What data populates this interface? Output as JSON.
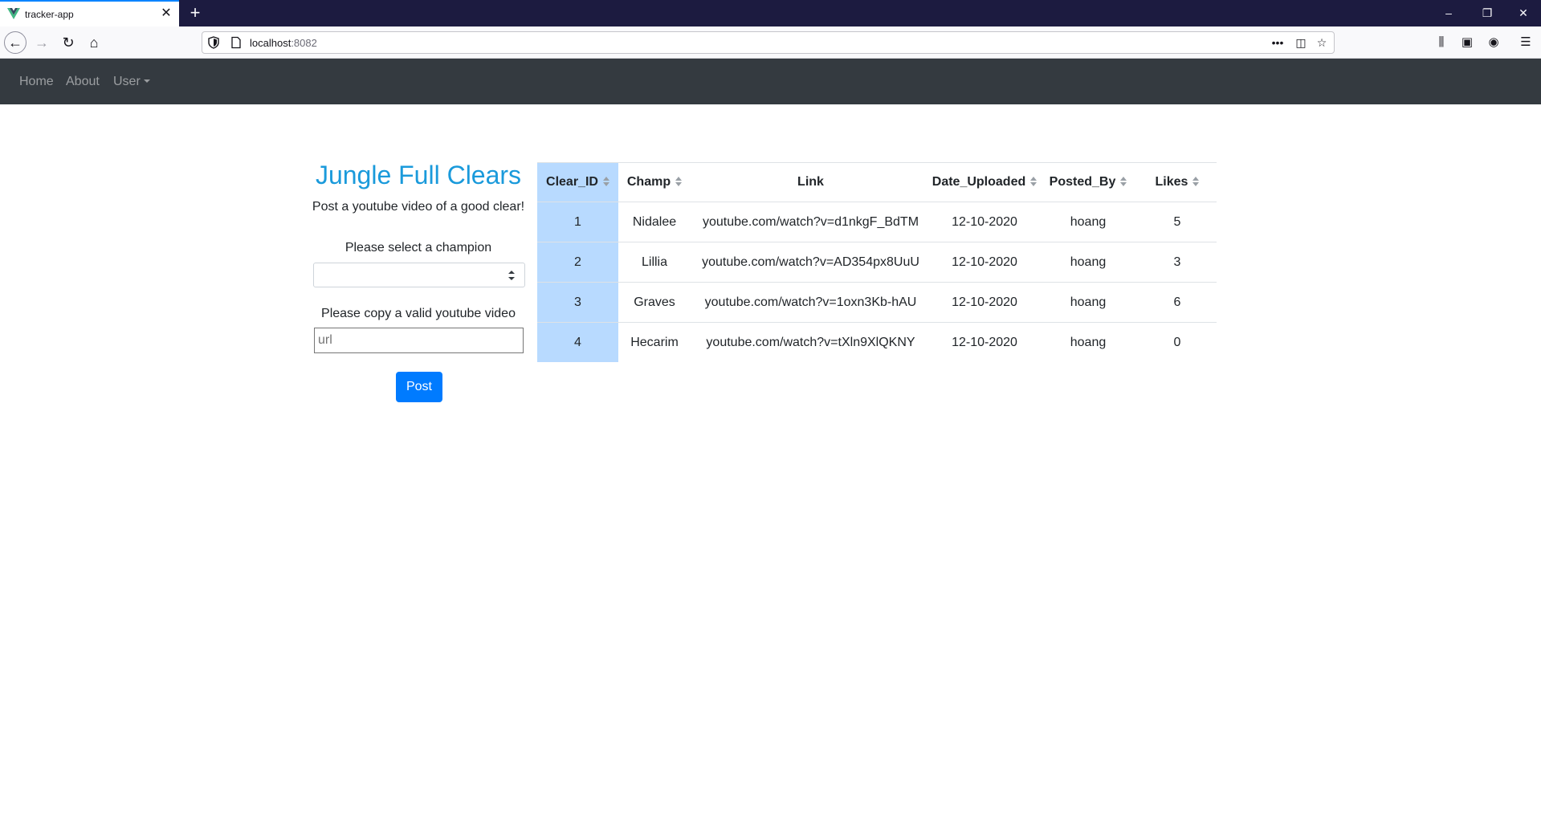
{
  "browser": {
    "tab_title": "tracker-app",
    "url_host": "localhost",
    "url_port": ":8082"
  },
  "navbar": {
    "links": [
      "Home",
      "About"
    ],
    "user_menu": "User"
  },
  "form": {
    "title": "Jungle Full Clears",
    "subtitle": "Post a youtube video of a good clear!",
    "champion_label": "Please select a champion",
    "champion_value": "",
    "url_label": "Please copy a valid youtube video",
    "url_placeholder": "url",
    "url_value": "",
    "post_label": "Post"
  },
  "table": {
    "columns": [
      "Clear_ID",
      "Champ",
      "Link",
      "Date_Uploaded",
      "Posted_By",
      "Likes"
    ],
    "rows": [
      [
        "1",
        "Nidalee",
        "youtube.com/watch?v=d1nkgF_BdTM",
        "12-10-2020",
        "hoang",
        "5"
      ],
      [
        "2",
        "Lillia",
        "youtube.com/watch?v=AD354px8UuU",
        "12-10-2020",
        "hoang",
        "3"
      ],
      [
        "3",
        "Graves",
        "youtube.com/watch?v=1oxn3Kb-hAU",
        "12-10-2020",
        "hoang",
        "6"
      ],
      [
        "4",
        "Hecarim",
        "youtube.com/watch?v=tXln9XlQKNY",
        "12-10-2020",
        "hoang",
        "0"
      ]
    ]
  },
  "colors": {
    "navbar_bg": "#343a40",
    "title": "#1a9adb",
    "primary_button": "#007bff",
    "id_column_bg": "#b8daff"
  }
}
